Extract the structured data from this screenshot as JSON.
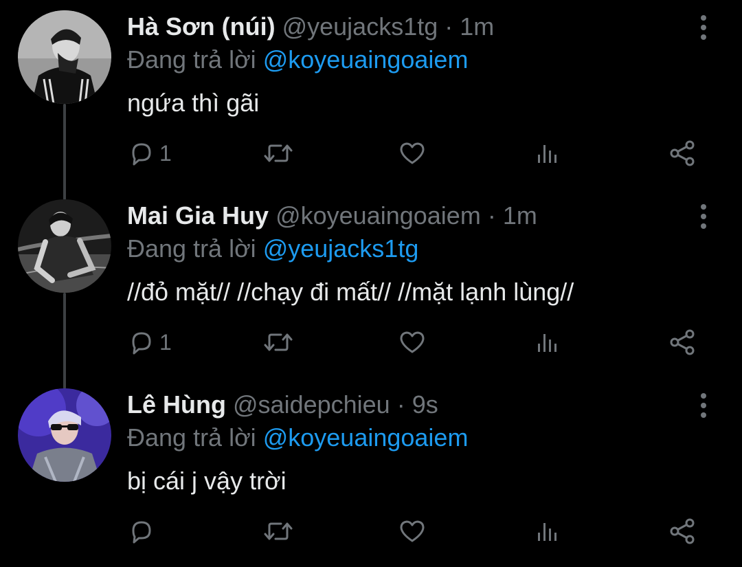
{
  "colors": {
    "background": "#000000",
    "text_primary": "#e7e9ea",
    "text_secondary": "#71767b",
    "link": "#1d9bf0",
    "thread_line": "#3d4043"
  },
  "icons": {
    "reply": "reply-icon",
    "retweet": "retweet-icon",
    "like": "heart-icon",
    "views": "bar-chart-icon",
    "share": "share-icon",
    "more": "more-vertical-icon"
  },
  "tweets": [
    {
      "name": "Hà Sơn (núi)",
      "handle": "@yeujacks1tg",
      "dot": "·",
      "time": "1m",
      "reply_prefix": "Đang trả lời",
      "reply_to": "@koyeuaingoaiem",
      "text": "ngứa thì gãi",
      "reply_count": "1"
    },
    {
      "name": "Mai Gia Huy",
      "handle": "@koyeuaingoaiem",
      "dot": "·",
      "time": "1m",
      "reply_prefix": "Đang trả lời",
      "reply_to": "@yeujacks1tg",
      "text": "//đỏ mặt// //chạy đi mất// //mặt lạnh lùng//",
      "reply_count": "1"
    },
    {
      "name": "Lê Hùng",
      "handle": "@saidepchieu",
      "dot": "·",
      "time": "9s",
      "reply_prefix": "Đang trả lời",
      "reply_to": "@koyeuaingoaiem",
      "text": "bị cái j vậy trời",
      "reply_count": ""
    }
  ]
}
